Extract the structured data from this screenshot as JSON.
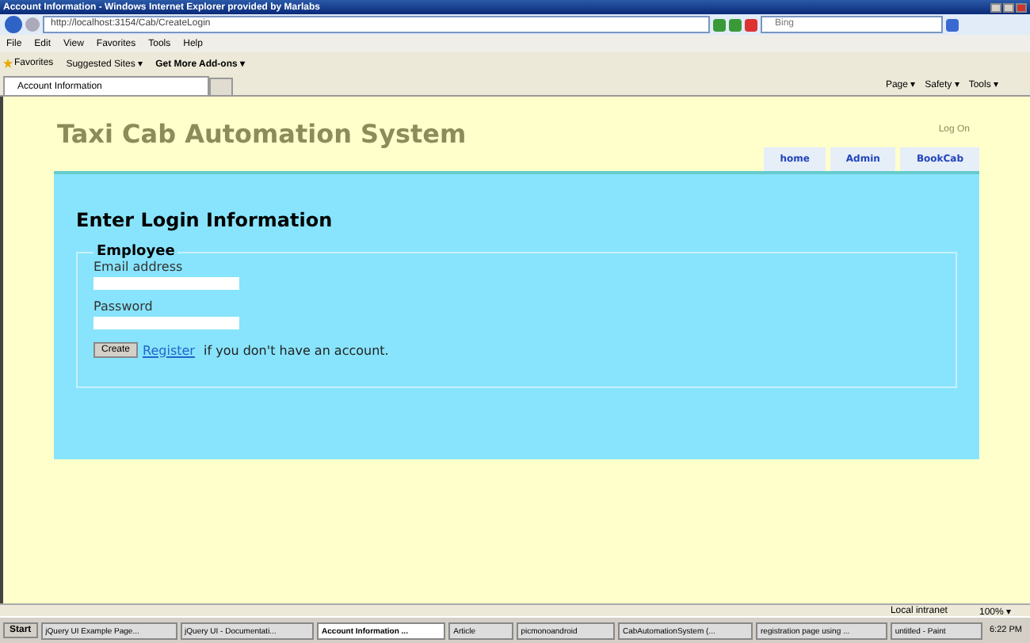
{
  "window": {
    "title": "Account Information - Windows Internet Explorer provided by Marlabs"
  },
  "address_bar": {
    "url": "http://localhost:3154/Cab/CreateLogin",
    "search_placeholder": "Bing"
  },
  "menu": [
    "File",
    "Edit",
    "View",
    "Favorites",
    "Tools",
    "Help"
  ],
  "favorites_bar": [
    {
      "label": "Favorites",
      "kind": "star"
    },
    {
      "label": "Suggested Sites ▾",
      "kind": "sites"
    },
    {
      "label": "Get More Add-ons ▾",
      "kind": "addons"
    }
  ],
  "tabs": [
    {
      "label": "Account Information",
      "selected": true
    }
  ],
  "command_bar": [
    "Page ▾",
    "Safety ▾",
    "Tools ▾"
  ],
  "page": {
    "site_title": "Taxi Cab Automation System",
    "login_link": "Log On",
    "nav": [
      {
        "label": "home"
      },
      {
        "label": "Admin"
      },
      {
        "label": "BookCab"
      }
    ],
    "heading": "Enter Login Information",
    "legend": "Employee",
    "fields": [
      {
        "label": "Email address"
      },
      {
        "label": "Password"
      }
    ],
    "button": "Create",
    "register_link": "Register",
    "register_text": " if you don't have an account."
  },
  "status_bar": {
    "zone": "Local intranet",
    "zoom": "100% ▾"
  },
  "taskbar": {
    "start": "Start",
    "items": [
      {
        "label": "jQuery UI Example Page...",
        "selected": false
      },
      {
        "label": "jQuery UI - Documentati...",
        "selected": false
      },
      {
        "label": "Account Information ...",
        "selected": true
      },
      {
        "label": "Article",
        "selected": false
      },
      {
        "label": "picmonoandroid",
        "selected": false
      },
      {
        "label": "CabAutomationSystem (...",
        "selected": false
      },
      {
        "label": "registration page using ...",
        "selected": false
      },
      {
        "label": "untitled - Paint",
        "selected": false
      }
    ],
    "clock": "6:22 PM"
  }
}
